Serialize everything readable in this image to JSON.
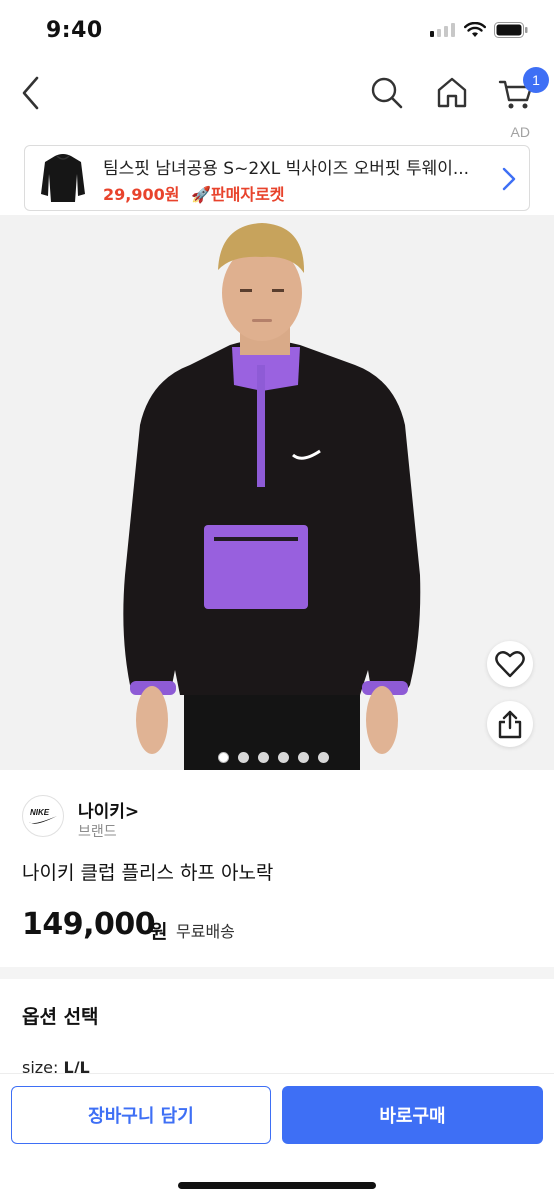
{
  "status_bar": {
    "time": "9:40"
  },
  "nav": {
    "cart_badge": "1"
  },
  "ad": {
    "label": "AD",
    "title": "팀스핏 남녀공용 S~2XL 빅사이즈 오버핏 투웨이...",
    "price": "29,900원",
    "tag": "🚀판매자로켓",
    "accent_color": "#e8432c"
  },
  "gallery": {
    "image_count": 6,
    "active_index": 0
  },
  "brand": {
    "name": "나이키>",
    "type": "브랜드",
    "logo_text": "NIKE"
  },
  "product": {
    "title": "나이키 클럽 플리스 하프 아노락",
    "price": "149,000",
    "price_unit": "원",
    "shipping": "무료배송"
  },
  "options": {
    "section_title": "옵션 선택",
    "size_label": "size: ",
    "size_value": "L/L"
  },
  "actions": {
    "cart_label": "장바구니 담기",
    "buy_label": "바로구매",
    "accent_color": "#3e6ff5"
  }
}
